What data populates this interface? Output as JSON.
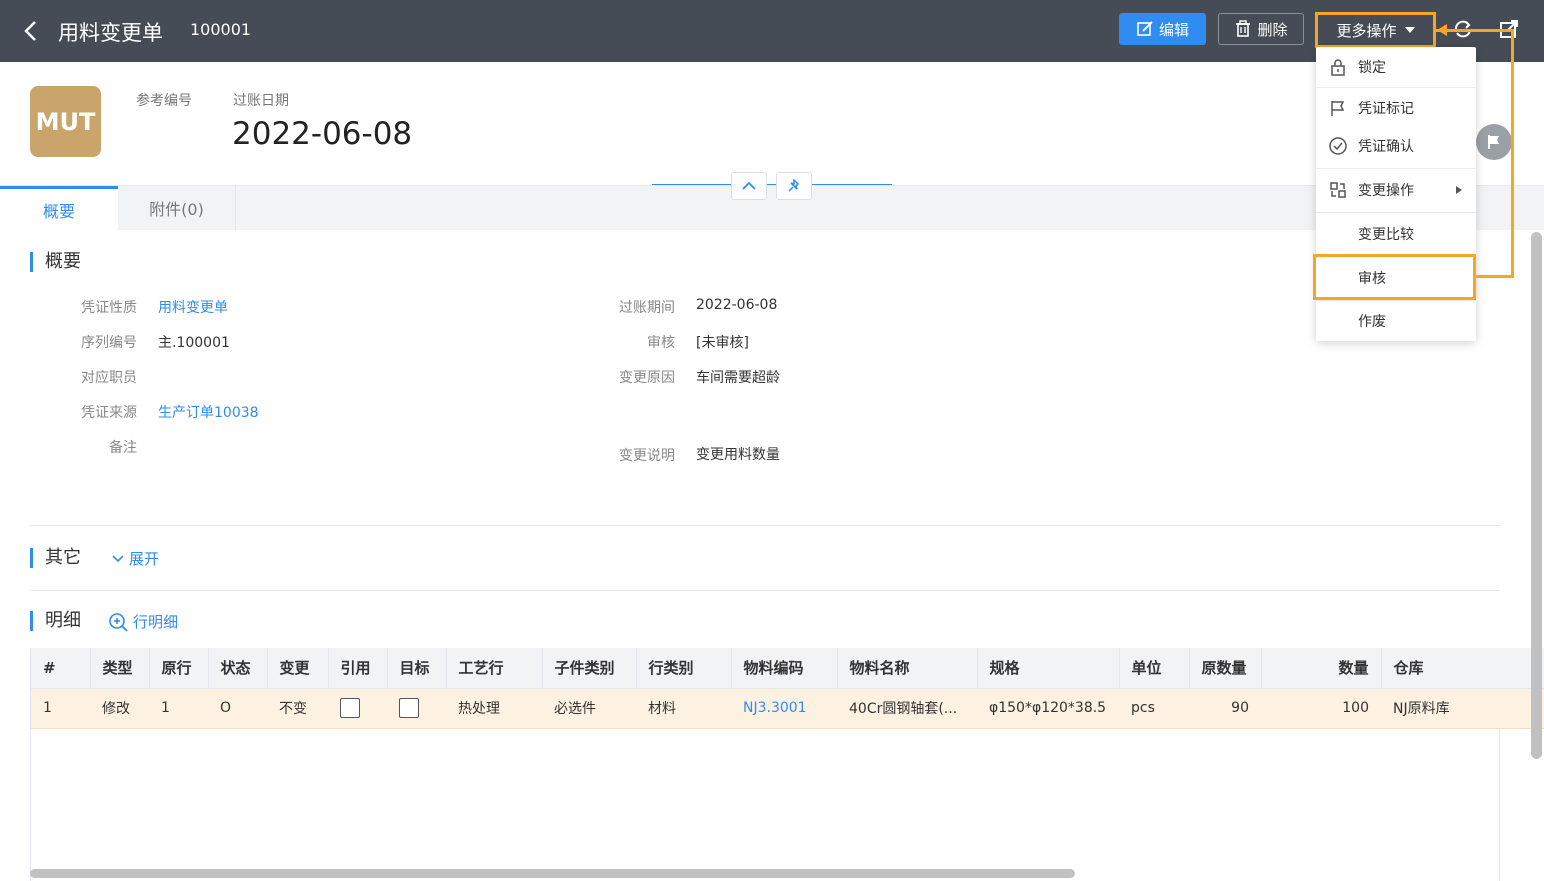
{
  "header": {
    "title": "用料变更单",
    "doc_number": "100001",
    "edit_label": "编辑",
    "delete_label": "删除",
    "more_label": "更多操作"
  },
  "doc": {
    "logo_text": "MUT",
    "ref_label": "参考编号",
    "date_label": "过账日期",
    "date_value": "2022-06-08"
  },
  "tabs": [
    {
      "label": "概要"
    },
    {
      "label": "附件(0)"
    }
  ],
  "summary": {
    "title": "概要",
    "fields_left": [
      {
        "label": "凭证性质",
        "value": "用料变更单"
      },
      {
        "label": "序列编号",
        "value": "主.100001"
      },
      {
        "label": "对应职员",
        "value": ""
      },
      {
        "label": "凭证来源",
        "value": "生产订单10038"
      },
      {
        "label": "备注",
        "value": ""
      }
    ],
    "fields_right": [
      {
        "label": "过账期间",
        "value": "2022-06-08"
      },
      {
        "label": "审核",
        "value": "[未审核]"
      },
      {
        "label": "变更原因",
        "value": "车间需要超龄"
      },
      {
        "label": "变更说明",
        "value": "变更用料数量"
      }
    ]
  },
  "other": {
    "title": "其它",
    "expand_label": "展开"
  },
  "details": {
    "title": "明细",
    "row_detail_label": "行明细",
    "columns": [
      "#",
      "类型",
      "原行",
      "状态",
      "变更",
      "引用",
      "目标",
      "工艺行",
      "子件类别",
      "行类别",
      "物料编码",
      "物料名称",
      "规格",
      "单位",
      "原数量",
      "数量",
      "仓库"
    ],
    "rows": [
      {
        "no": "1",
        "type": "修改",
        "orig_line": "1",
        "status": "O",
        "change": "不变",
        "ref": "",
        "target": "",
        "process": "热处理",
        "sub_type": "必选件",
        "line_type": "材料",
        "item_code": "NJ3.3001",
        "item_name": "40Cr圆钢轴套(...",
        "spec": "φ150*φ120*38.5",
        "unit": "pcs",
        "orig_qty": "90",
        "qty": "100",
        "warehouse": "NJ原料库"
      }
    ]
  },
  "menu": {
    "items": [
      {
        "label": "锁定",
        "icon": "lock-icon"
      },
      {
        "label": "凭证标记",
        "icon": "flag-icon"
      },
      {
        "label": "凭证确认",
        "icon": "check-circle-icon"
      },
      {
        "label": "变更操作",
        "icon": "swap-icon"
      },
      {
        "label": "变更比较",
        "icon": ""
      },
      {
        "label": "审核",
        "icon": ""
      },
      {
        "label": "作废",
        "icon": ""
      }
    ]
  },
  "colors": {
    "accent": "#2f8cf0",
    "topbar": "#454c55",
    "highlight": "#f5a623",
    "logo": "#c9a56c"
  }
}
